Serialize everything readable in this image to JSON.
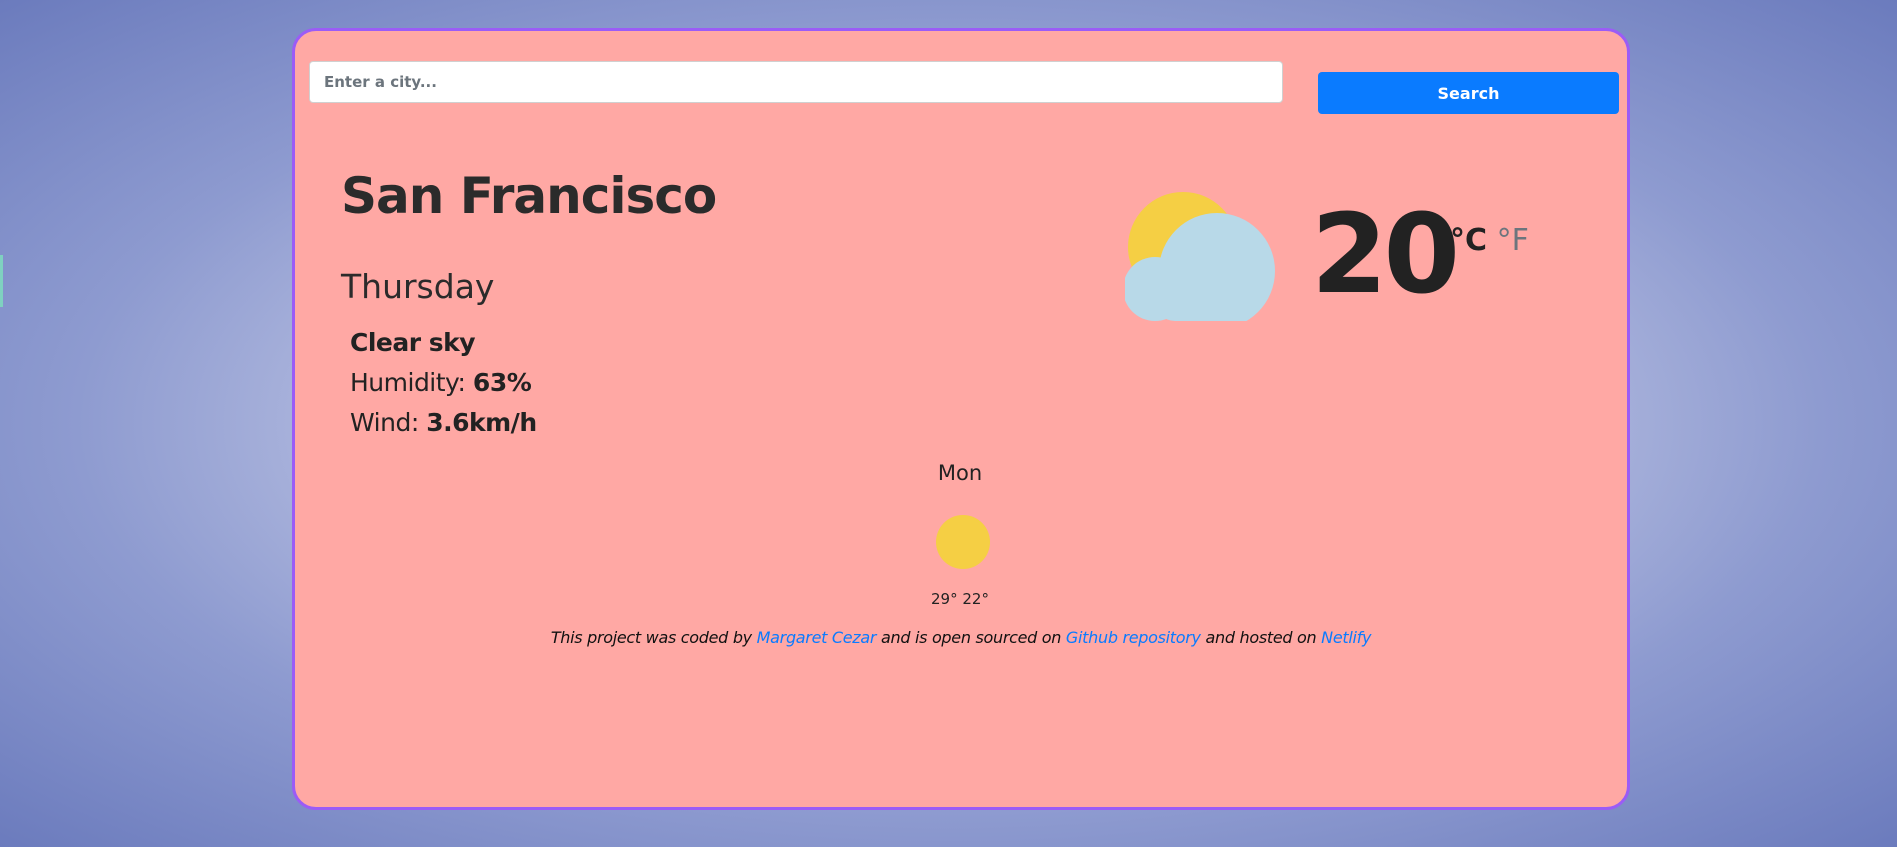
{
  "search": {
    "placeholder": "Enter a city...",
    "button_label": "Search"
  },
  "current": {
    "city": "San Francisco",
    "day": "Thursday",
    "description": "Clear sky",
    "humidity_label": "Humidity:",
    "humidity_value": "63%",
    "wind_label": "Wind:",
    "wind_value": "3.6km/h",
    "temperature": "20",
    "unit_celsius": "°C",
    "unit_fahrenheit": "°F",
    "icon": "partly-cloudy-icon"
  },
  "forecast": [
    {
      "day": "Mon",
      "temps": "29° 22°",
      "icon": "sun-icon"
    }
  ],
  "footer": {
    "text_1": "This project was coded by",
    "author_link": "Margaret Cezar",
    "text_2": "and is open sourced on",
    "repo_link": "Github repository",
    "text_3": "and hosted on",
    "host_link": "Netlify"
  },
  "colors": {
    "card_background": "#ffa8a4",
    "card_border": "#9b5cf6",
    "accent": "#0a7bff",
    "sun": "#f5cf44",
    "cloud": "#b8d9e8"
  }
}
